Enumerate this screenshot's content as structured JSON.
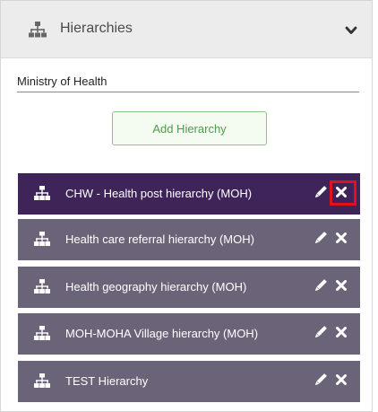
{
  "header": {
    "title": "Hierarchies",
    "icon": "sitemap-icon",
    "toggle_icon": "chevron-down-icon"
  },
  "organisation": {
    "selected": "Ministry of Health"
  },
  "actions": {
    "add_label": "Add Hierarchy"
  },
  "hierarchies": [
    {
      "label": "CHW - Health post hierarchy (MOH)",
      "selected": true,
      "delete_highlighted": true
    },
    {
      "label": "Health care referral hierarchy (MOH)",
      "selected": false
    },
    {
      "label": "Health geography hierarchy (MOH)",
      "selected": false
    },
    {
      "label": "MOH-MOHA Village hierarchy (MOH)",
      "selected": false
    },
    {
      "label": "TEST Hierarchy",
      "selected": false
    }
  ],
  "colors": {
    "header_bg": "#ececec",
    "row_bg": "#6b6378",
    "row_selected_bg": "#3f2459",
    "add_button_border": "#8bc58b",
    "add_button_text": "#4e9a4e",
    "highlight": "#e0121b"
  }
}
